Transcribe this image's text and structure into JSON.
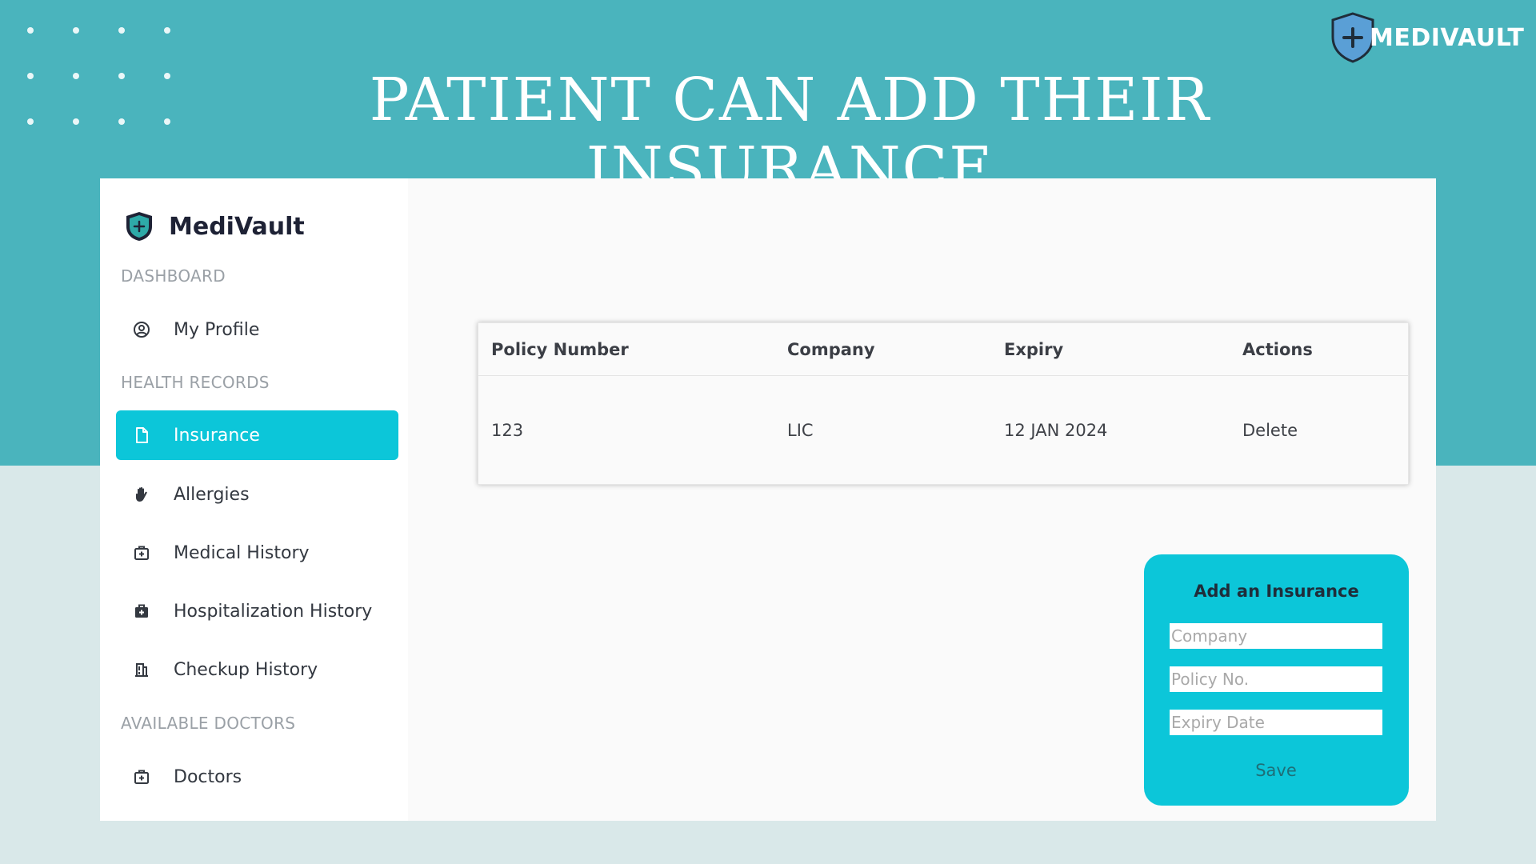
{
  "slide": {
    "title": "PATIENT CAN ADD THEIR INSURANCE",
    "brand_text": "MEDIVAULT"
  },
  "colors": {
    "teal_background": "#4ab4bd",
    "light_background": "#d9e8e9",
    "accent": "#0cc6d9",
    "brand_shield": "#5a9fd6"
  },
  "sidebar": {
    "app_name": "MediVault",
    "sections": {
      "dashboard": "DASHBOARD",
      "health_records": "HEALTH RECORDS",
      "available_doctors": "AVAILABLE DOCTORS"
    },
    "items": [
      {
        "label": "My Profile",
        "icon": "user-circle-icon"
      },
      {
        "label": "Insurance",
        "icon": "document-icon",
        "active": true
      },
      {
        "label": "Allergies",
        "icon": "hand-icon"
      },
      {
        "label": "Medical History",
        "icon": "medical-kit-icon"
      },
      {
        "label": "Hospitalization History",
        "icon": "briefcase-medical-icon"
      },
      {
        "label": "Checkup History",
        "icon": "clinic-icon"
      },
      {
        "label": "Doctors",
        "icon": "medical-kit-icon"
      }
    ]
  },
  "table": {
    "headers": [
      "Policy Number",
      "Company",
      "Expiry",
      "Actions"
    ],
    "rows": [
      {
        "policy_number": "123",
        "company": "LIC",
        "expiry": "12 JAN 2024",
        "action": "Delete"
      }
    ]
  },
  "form": {
    "title": "Add an Insurance",
    "company_placeholder": "Company",
    "policy_placeholder": "Policy No.",
    "expiry_placeholder": "Expiry Date",
    "save_label": "Save"
  }
}
